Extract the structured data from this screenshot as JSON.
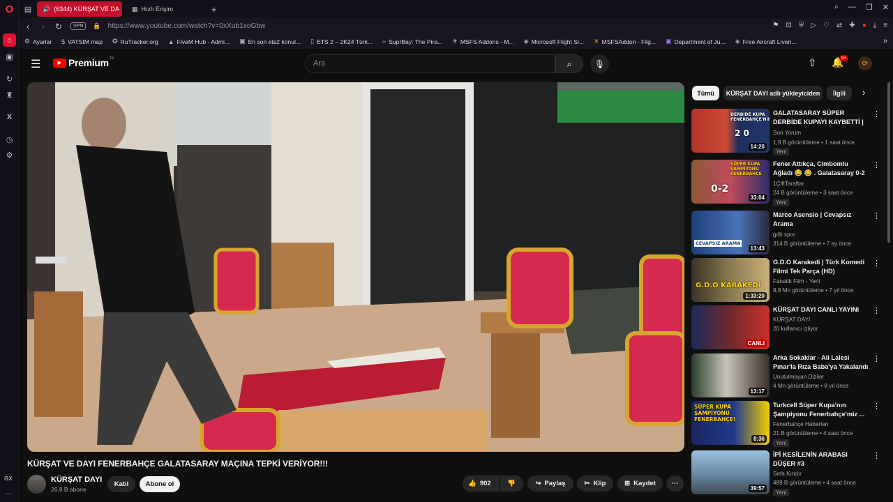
{
  "browser": {
    "tabs": [
      {
        "label": "(6344) KÜRŞAT VE DA",
        "active": true
      },
      {
        "label": "Hızlı Erişim",
        "active": false
      }
    ],
    "url": "https://www.youtube.com/watch?v=0xXub1xoGbw",
    "vpn_label": "VPN",
    "bookmarks": [
      "Ayarlar",
      "VATSIM map",
      "RuTracker.org",
      "FiveM Hub - Admi...",
      "En son ets2 konul...",
      "ETS 2 – 2K24 Türk...",
      "SuprBay: The Pira...",
      "MSFS Addons - M...",
      "Microsoft Flight Si...",
      "MSFSAddon - Filg...",
      "Department of Ju...",
      "Free Aircraft Liveri..."
    ],
    "rail_gx": "GX"
  },
  "youtube": {
    "logo_text": "Premium",
    "logo_sup": "TR",
    "search_placeholder": "Ara",
    "notification_count": "9+"
  },
  "video": {
    "title": "KÜRŞAT VE DAYI FENERBAHÇE GALATASARAY MAÇINA TEPKİ VERİYOR!!!",
    "channel": "KÜRŞAT DAYI",
    "subscribers": "26,8 B abone",
    "join_label": "Katıl",
    "subscribe_label": "Abone ol",
    "likes": "902",
    "share_label": "Paylaş",
    "clip_label": "Klip",
    "save_label": "Kaydet"
  },
  "chips": [
    "Tümü",
    "KÜRŞAT DAYI adlı yükleyiciden",
    "İlgili"
  ],
  "recommendations": [
    {
      "title": "GALATASARAY SÜPER DERBİDE KUPAYI KAYBETTİ | Fenerbahç...",
      "channel": "Son Yorum",
      "meta": "1,9 B görüntüleme • 1 saat önce",
      "badge": "Yeni",
      "duration": "14:20",
      "thumb_text": "DERBİDE KUPA FENERBAHÇE'NİN"
    },
    {
      "title": "Fener Attıkça, Cimbomlu Ağladı 😂 😂 . Galatasaray 0-2 ...",
      "channel": "1ÇiftTaraftar",
      "meta": "24 B görüntüleme • 3 saat önce",
      "badge": "Yeni",
      "duration": "33:04",
      "thumb_text": "SÜPER KUPA ŞAMPİYONU FENERBAHÇE"
    },
    {
      "title": "Marco Asensio | Cevapsız Arama",
      "channel": "gdh spor",
      "meta": "314 B görüntüleme • 7 ay önce",
      "badge": "",
      "duration": "13:43",
      "thumb_text": "CEVAPSIZ ARAMA"
    },
    {
      "title": "G.D.O Karakedi | Türk Komedi Filmi Tek Parça (HD)",
      "channel": "Fanatik Film - Yerli",
      "meta": "9,9 Mn görüntüleme • 7 yıl önce",
      "badge": "",
      "duration": "1:33:20",
      "thumb_text": "G.D.O KARAKEDİ"
    },
    {
      "title": "KÜRŞAT DAYI CANLI YAYINI",
      "channel": "KÜRŞAT DAYI",
      "meta": "20 kullanıcı izliyor",
      "badge": "",
      "duration": "CANLI",
      "thumb_text": ""
    },
    {
      "title": "Arka Sokaklar - Ali Lalesi Pınar'la Rıza Baba'ya Yakalandı",
      "channel": "Unutulmayan Diziler",
      "meta": "4 Mn görüntüleme • 8 yıl önce",
      "badge": "",
      "duration": "13:17",
      "thumb_text": ""
    },
    {
      "title": "Turkcell Süper Kupa'nın Şampiyonu Fenerbahçe'miz ...",
      "channel": "Fenerbahçe Haberleri",
      "meta": "21 B görüntüleme • 4 saat önce",
      "badge": "Yeni",
      "duration": "8:36",
      "thumb_text": "SÜPER KUPA ŞAMPİYONU FENERBAHÇE!"
    },
    {
      "title": "İPİ KESİLENİN ARABASI DÜŞER #3",
      "channel": "Sefa Kındır",
      "meta": "489 B görüntüleme • 4 saat önce",
      "badge": "Yeni",
      "duration": "39:57",
      "thumb_text": ""
    }
  ]
}
